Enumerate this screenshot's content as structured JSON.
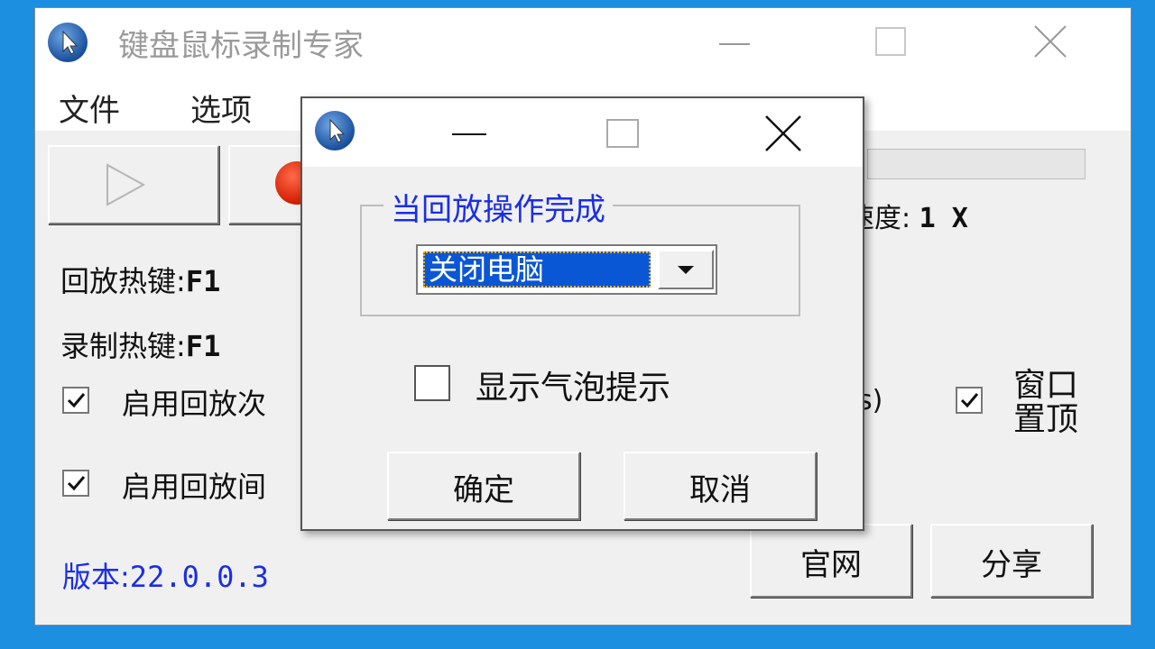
{
  "main_window": {
    "title": "键盘鼠标录制专家",
    "menu": {
      "file": "文件",
      "options": "选项"
    },
    "speed": {
      "label": "速度:",
      "value": "1 X"
    },
    "hotkeys": {
      "play_label": "回放热键:",
      "play_value": "F1",
      "record_label": "录制热键:",
      "record_value": "F1"
    },
    "checkboxes": {
      "playback_count_label": "启用回放次",
      "playback_count_checked": true,
      "playback_interval_label": "启用回放间",
      "playback_interval_checked": true,
      "paren_fragment": "s)",
      "window_top_label": "窗口置顶",
      "window_top_checked": true
    },
    "version": {
      "label": "版本:",
      "number": "22.0.0.3"
    },
    "buttons": {
      "website": "官网",
      "share": "分享"
    }
  },
  "dialog": {
    "group_title": "当回放操作完成",
    "action_select_value": "关闭电脑",
    "bubble_label": "显示气泡提示",
    "bubble_checked": false,
    "ok_label": "确定",
    "cancel_label": "取消"
  },
  "colors": {
    "desktop": "#1d8fe0",
    "accent_blue_text": "#1a2ee6",
    "selection": "#0a57d6",
    "record_red": "#d21c00"
  },
  "icons": {
    "app": "app-cursor-icon",
    "play": "play-icon",
    "record": "record-icon",
    "minimize": "minimize-icon",
    "maximize": "maximize-icon",
    "close": "close-icon",
    "dropdown": "chevron-down-icon",
    "check": "check-icon"
  }
}
